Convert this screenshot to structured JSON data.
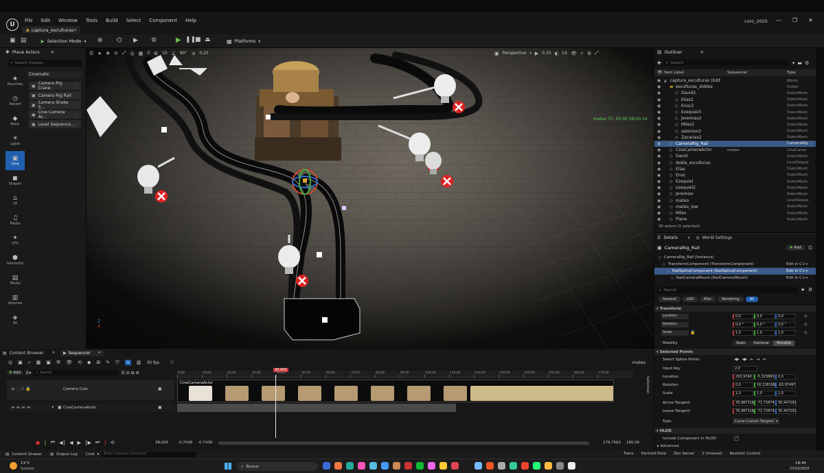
{
  "window": {
    "project_tab": "captura_esculturas•",
    "project_name": "coro_2025"
  },
  "menu": [
    "File",
    "Edit",
    "Window",
    "Tools",
    "Build",
    "Select",
    "Component",
    "Help"
  ],
  "toolbar": {
    "selection_mode": "Selection Mode",
    "platforms": "Platforms"
  },
  "place_actors": {
    "title": "Place Actors",
    "search_placeholder": "Search Classes",
    "category": "Cinematic",
    "items": [
      "Camera Rig Crane",
      "Camera Rig Rail",
      "Camera Shake S...",
      "Cine Camera Ac...",
      "Level Sequence..."
    ],
    "categories": [
      "Favorites",
      "Recent",
      "Basic",
      "Lights",
      "Cine",
      "Shapes",
      "VP",
      "Media",
      "VFX",
      "Geometry",
      "Media",
      "Volumes",
      "All"
    ]
  },
  "viewport": {
    "perspective": "Perspective",
    "lit": "Lit",
    "grid_snap": "10",
    "rot_snap": "90°",
    "scale_snap": "0,25",
    "fov": "0,33",
    "cam_speed": "0",
    "timecode": "mateo TC: 00:00:38:00:14"
  },
  "outliner": {
    "title": "Outliner",
    "search_placeholder": "Search",
    "col_label": "Item Label",
    "col_seq": "Sequencer",
    "col_type": "Type",
    "rows": [
      {
        "name": "captura_esculturas (Edit",
        "type": "World",
        "indent": 0,
        "kind": "world"
      },
      {
        "name": "esculturas_dobles",
        "type": "Folder",
        "indent": 1,
        "kind": "folder"
      },
      {
        "name": "David2",
        "type": "StaticMesh",
        "indent": 2,
        "kind": "mesh"
      },
      {
        "name": "Elias2",
        "type": "StaticMesh",
        "indent": 2,
        "kind": "mesh"
      },
      {
        "name": "Enoc2",
        "type": "StaticMesh",
        "indent": 2,
        "kind": "mesh"
      },
      {
        "name": "Ezequiel3",
        "type": "StaticMesh",
        "indent": 2,
        "kind": "mesh"
      },
      {
        "name": "Jeremias2",
        "type": "StaticMesh",
        "indent": 2,
        "kind": "mesh"
      },
      {
        "name": "Miles2",
        "type": "StaticMesh",
        "indent": 2,
        "kind": "mesh"
      },
      {
        "name": "salomon2",
        "type": "StaticMesh",
        "indent": 2,
        "kind": "mesh"
      },
      {
        "name": "Zacarias2",
        "type": "StaticMesh",
        "indent": 2,
        "kind": "mesh"
      },
      {
        "name": "CameraRig_Rail",
        "type": "CameraRig",
        "indent": 1,
        "kind": "mesh",
        "selected": true
      },
      {
        "name": "CineCameraActor",
        "type": "CineCame",
        "indent": 1,
        "kind": "mesh",
        "seq": "mateo"
      },
      {
        "name": "David",
        "type": "StaticMesh",
        "indent": 1,
        "kind": "mesh"
      },
      {
        "name": "doble_esculturas",
        "type": "LevelSeque",
        "indent": 1,
        "kind": "mesh"
      },
      {
        "name": "Elias",
        "type": "StaticMesh",
        "indent": 1,
        "kind": "mesh"
      },
      {
        "name": "Enoc",
        "type": "StaticMesh",
        "indent": 1,
        "kind": "mesh"
      },
      {
        "name": "Ezequiel",
        "type": "StaticMesh",
        "indent": 1,
        "kind": "mesh"
      },
      {
        "name": "ezequiel2",
        "type": "StaticMesh",
        "indent": 1,
        "kind": "mesh"
      },
      {
        "name": "Jeremias",
        "type": "StaticMesh",
        "indent": 1,
        "kind": "mesh"
      },
      {
        "name": "mateo",
        "type": "LevelSeque",
        "indent": 1,
        "kind": "mesh"
      },
      {
        "name": "mateo_low",
        "type": "StaticMesh",
        "indent": 1,
        "kind": "mesh"
      },
      {
        "name": "Miles",
        "type": "StaticMesh",
        "indent": 1,
        "kind": "mesh"
      },
      {
        "name": "Plane",
        "type": "StaticMesh",
        "indent": 1,
        "kind": "mesh"
      }
    ],
    "footer": "36 actors (1 selected)"
  },
  "details": {
    "tab_details": "Details",
    "tab_world": "World Settings",
    "actor_name": "CameraRig_Rail",
    "add_label": "Add",
    "components": [
      {
        "name": "CameraRig_Rail (Instance)",
        "edit": ""
      },
      {
        "name": "TransformComponent (TransformComponent)",
        "edit": "Edit in C++"
      },
      {
        "name": "RailSplineComponent (RailSplineComponent)",
        "edit": "Edit in C++"
      },
      {
        "name": "RailCameraMount (RailCameraMount)",
        "edit": "Edit in C++"
      }
    ],
    "search_placeholder": "Search",
    "filters": [
      "General",
      "LOD",
      "Misc",
      "Rendering",
      "All"
    ],
    "transform_header": "Transform",
    "location": {
      "label": "Location",
      "x": "0,0",
      "y": "0,0",
      "z": "0,0"
    },
    "rotation": {
      "label": "Rotation",
      "x": "0,0 °",
      "y": "0,0 °",
      "z": "0,0 °"
    },
    "scale": {
      "label": "Scale",
      "x": "1,0",
      "y": "1,0",
      "z": "1,0"
    },
    "mobility": {
      "label": "Mobility",
      "options": [
        "Static",
        "Stationar",
        "Movable"
      ]
    },
    "selected_points_header": "Selected Points",
    "select_spline_points": "Select Spline Points",
    "input_key": {
      "label": "Input Key",
      "value": "2,0"
    },
    "sp_location": {
      "label": "Location",
      "x": "293,9740",
      "y": "-5,323865",
      "z": "0,0"
    },
    "sp_rotation": {
      "label": "Rotation",
      "x": "0,0",
      "y": "16,138188",
      "z": "-82,97497"
    },
    "sp_scale": {
      "label": "Scale",
      "x": "1,0",
      "y": "1,0",
      "z": "1,0"
    },
    "arrive_tangent": {
      "label": "Arrive Tangent",
      "x": "76,987316",
      "y": "-71,72874",
      "z": "30,447291"
    },
    "leave_tangent": {
      "label": "Leave Tangent",
      "x": "76,987316",
      "y": "-71,72874",
      "z": "30,447291"
    },
    "type": {
      "label": "Type",
      "value": "Curve Custom Tangent"
    },
    "hlod_header": "HLOD",
    "include_hlod": "Include Component in HLOD",
    "advanced": "Advanced"
  },
  "bottom_tabs": {
    "content_browser": "Content Browser",
    "sequencer": "Sequencer"
  },
  "sequencer": {
    "add_label": "Add",
    "search_placeholder": "Search",
    "fps": "30 fps",
    "sequence_name": "mateo",
    "tracks": [
      "Camera Cuts",
      "CineCameraActor"
    ],
    "clip_label": "CineCameraActor",
    "playhead": "38,005",
    "ruler": [
      "0,00",
      "10,00",
      "20,00",
      "30,00",
      "40,00",
      "50,00",
      "60,00",
      "70,00",
      "80,00",
      "90,00",
      "100,00",
      "110,00",
      "120,00",
      "130,00",
      "140,00",
      "150,00",
      "160,00",
      "170,00"
    ],
    "time_current": "38,005",
    "range_start_1": "-0,7438",
    "range_start_2": "-0,7438",
    "range_end_1": "179,7562",
    "range_end_2": "180,00",
    "selection_label": "Selection"
  },
  "statusbar": {
    "content_drawer": "Content Drawer",
    "output_log": "Output Log",
    "cmd": "Cmd",
    "console_placeholder": "Enter Console Command",
    "trace": "Trace",
    "derived_data": "Derived Data",
    "zen_server": "Zen Server",
    "unsaved": "2 Unsaved",
    "revision": "Revision Control"
  },
  "taskbar": {
    "temp": "11°C",
    "weather": "Soleado",
    "search": "Buscar",
    "time": "18:44",
    "date": "27/03/2025"
  }
}
